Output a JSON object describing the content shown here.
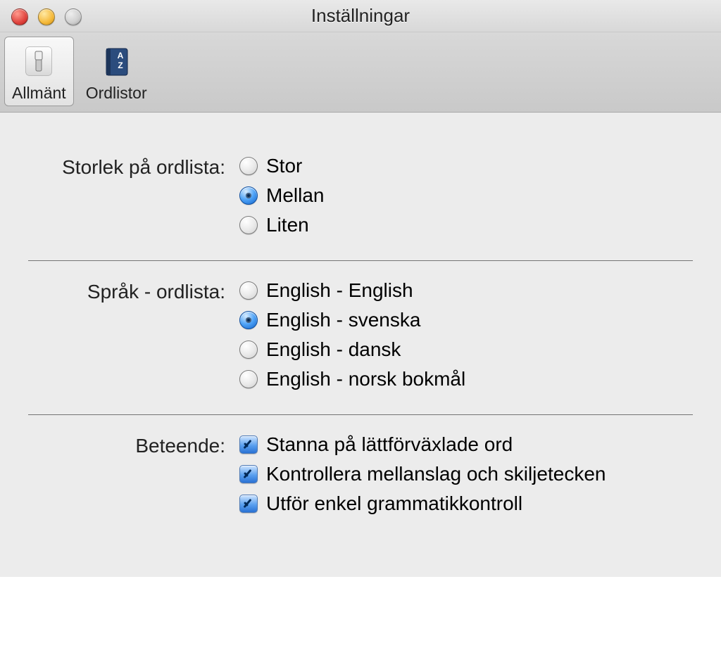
{
  "window": {
    "title": "Inställningar"
  },
  "toolbar": {
    "items": [
      {
        "label": "Allmänt",
        "icon": "switch-icon",
        "selected": true
      },
      {
        "label": "Ordlistor",
        "icon": "book-icon",
        "selected": false
      }
    ]
  },
  "sections": {
    "size": {
      "label": "Storlek på ordlista:",
      "options": [
        {
          "label": "Stor",
          "selected": false
        },
        {
          "label": "Mellan",
          "selected": true
        },
        {
          "label": "Liten",
          "selected": false
        }
      ]
    },
    "lang": {
      "label": "Språk - ordlista:",
      "options": [
        {
          "label": "English - English",
          "selected": false
        },
        {
          "label": "English - svenska",
          "selected": true
        },
        {
          "label": "English - dansk",
          "selected": false
        },
        {
          "label": "English - norsk bokmål",
          "selected": false
        }
      ]
    },
    "behaviour": {
      "label": "Beteende:",
      "options": [
        {
          "label": "Stanna på lättförväxlade ord",
          "checked": true
        },
        {
          "label": "Kontrollera mellanslag och skiljetecken",
          "checked": true
        },
        {
          "label": "Utför enkel grammatikkontroll",
          "checked": true
        }
      ]
    }
  }
}
